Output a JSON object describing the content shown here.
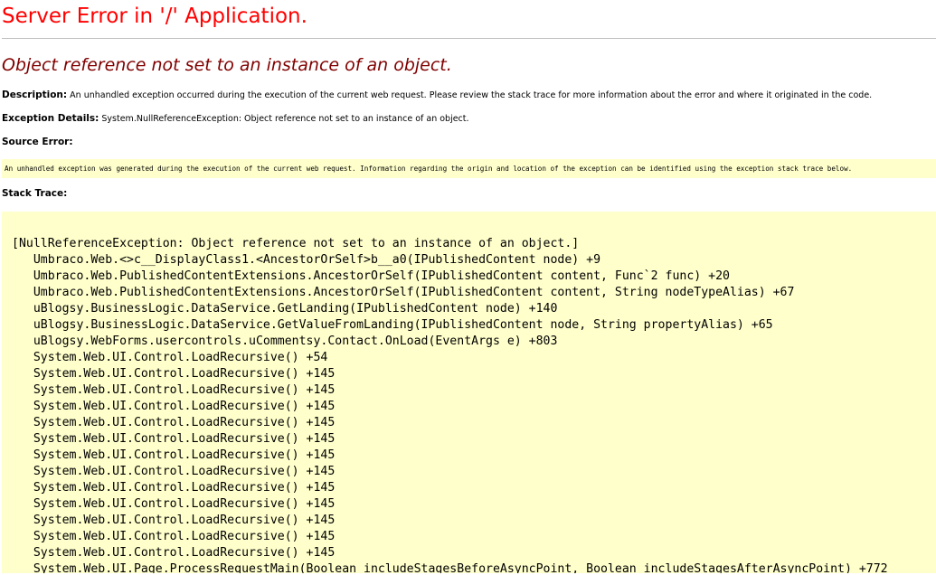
{
  "page": {
    "title": "Server Error in '/' Application.",
    "error_message": "Object reference not set to an instance of an object.",
    "description_label": "Description:",
    "description_text": "An unhandled exception occurred during the execution of the current web request. Please review the stack trace for more information about the error and where it originated in the code.",
    "exception_label": "Exception Details:",
    "exception_text": "System.NullReferenceException: Object reference not set to an instance of an object.",
    "source_error_label": "Source Error:",
    "source_error_notice": "An unhandled exception was generated during the execution of the current web request. Information regarding the origin and location of the exception can be identified using the exception stack trace below.",
    "stack_trace_label": "Stack Trace:"
  },
  "stack_trace": [
    "[NullReferenceException: Object reference not set to an instance of an object.]",
    "   Umbraco.Web.<>c__DisplayClass1.<AncestorOrSelf>b__a0(IPublishedContent node) +9",
    "   Umbraco.Web.PublishedContentExtensions.AncestorOrSelf(IPublishedContent content, Func`2 func) +20",
    "   Umbraco.Web.PublishedContentExtensions.AncestorOrSelf(IPublishedContent content, String nodeTypeAlias) +67",
    "   uBlogsy.BusinessLogic.DataService.GetLanding(IPublishedContent node) +140",
    "   uBlogsy.BusinessLogic.DataService.GetValueFromLanding(IPublishedContent node, String propertyAlias) +65",
    "   uBlogsy.WebForms.usercontrols.uCommentsy.Contact.OnLoad(EventArgs e) +803",
    "   System.Web.UI.Control.LoadRecursive() +54",
    "   System.Web.UI.Control.LoadRecursive() +145",
    "   System.Web.UI.Control.LoadRecursive() +145",
    "   System.Web.UI.Control.LoadRecursive() +145",
    "   System.Web.UI.Control.LoadRecursive() +145",
    "   System.Web.UI.Control.LoadRecursive() +145",
    "   System.Web.UI.Control.LoadRecursive() +145",
    "   System.Web.UI.Control.LoadRecursive() +145",
    "   System.Web.UI.Control.LoadRecursive() +145",
    "   System.Web.UI.Control.LoadRecursive() +145",
    "   System.Web.UI.Control.LoadRecursive() +145",
    "   System.Web.UI.Control.LoadRecursive() +145",
    "   System.Web.UI.Control.LoadRecursive() +145",
    "   System.Web.UI.Page.ProcessRequestMain(Boolean includeStagesBeforeAsyncPoint, Boolean includeStagesAfterAsyncPoint) +772"
  ],
  "colors": {
    "title": "#ff0000",
    "error_message": "#800000",
    "code_background": "#ffffcc"
  }
}
